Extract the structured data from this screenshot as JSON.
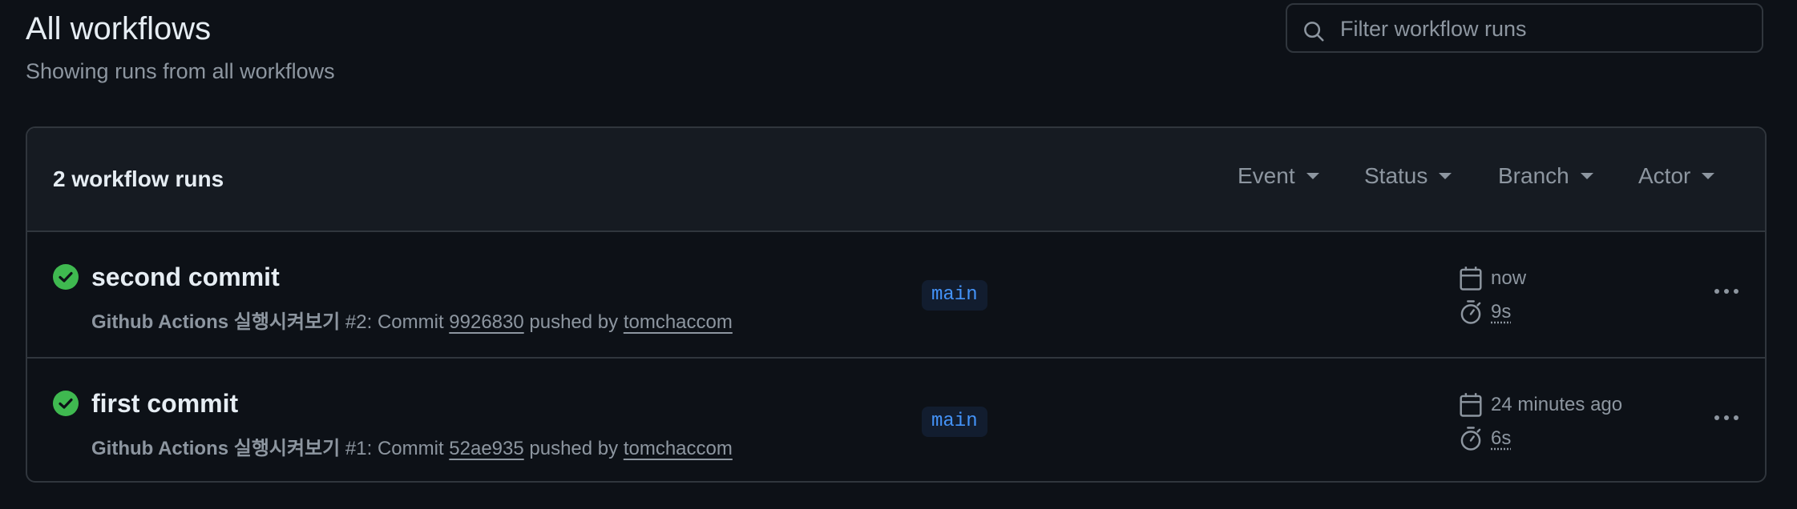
{
  "header": {
    "title": "All workflows",
    "subtitle": "Showing runs from all workflows"
  },
  "search": {
    "placeholder": "Filter workflow runs",
    "icon": "search-icon"
  },
  "runs_box": {
    "count_label": "2 workflow runs",
    "filters": [
      {
        "label": "Event"
      },
      {
        "label": "Status"
      },
      {
        "label": "Branch"
      },
      {
        "label": "Actor"
      }
    ]
  },
  "runs": [
    {
      "title": "second commit",
      "status": "success",
      "workflow": "Github Actions 실행시켜보기",
      "run_text": " #2: Commit ",
      "commit": "9926830",
      "pushed_by_text": " pushed by ",
      "actor": "tomchaccom",
      "branch": "main",
      "time": "now",
      "duration": "9s"
    },
    {
      "title": "first commit",
      "status": "success",
      "workflow": "Github Actions 실행시켜보기",
      "run_text": " #1: Commit ",
      "commit": "52ae935",
      "pushed_by_text": " pushed by ",
      "actor": "tomchaccom",
      "branch": "main",
      "time": "24 minutes ago",
      "duration": "6s"
    }
  ],
  "colors": {
    "background": "#0d1117",
    "success": "#3fb950",
    "branch_text": "#4493f8",
    "muted_text": "#8d96a0"
  }
}
